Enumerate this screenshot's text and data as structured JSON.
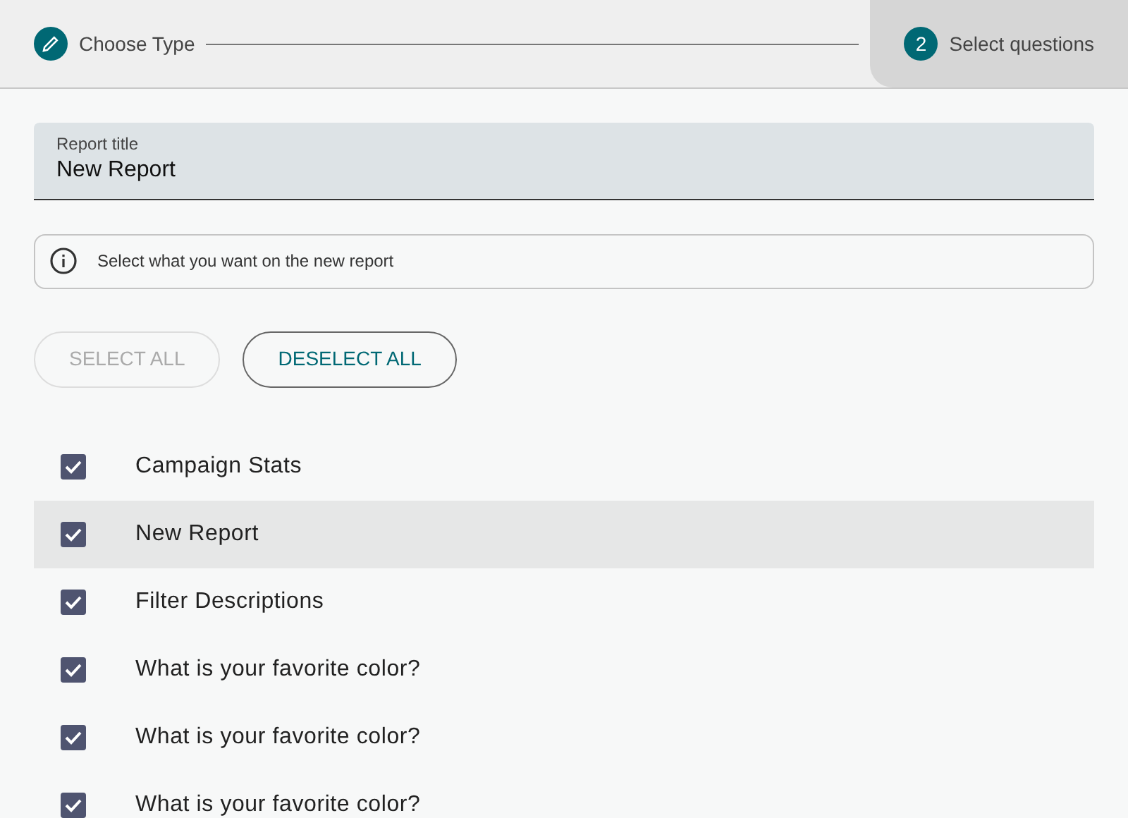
{
  "stepper": {
    "steps": [
      {
        "kind": "edit",
        "label": "Choose Type",
        "selected": false
      },
      {
        "kind": "number",
        "number": "2",
        "label": "Select questions",
        "selected": true
      }
    ]
  },
  "report_title": {
    "label": "Report title",
    "value": "New Report"
  },
  "info": {
    "text": "Select what you want on the new report"
  },
  "buttons": [
    {
      "label": "SELECT ALL",
      "disabled": true
    },
    {
      "label": "DESELECT ALL",
      "disabled": false
    }
  ],
  "questions": [
    {
      "label": "Campaign Stats",
      "checked": true,
      "highlighted": false
    },
    {
      "label": "New Report",
      "checked": true,
      "highlighted": true
    },
    {
      "label": "Filter Descriptions",
      "checked": true,
      "highlighted": false
    },
    {
      "label": "What is your favorite color?",
      "checked": true,
      "highlighted": false
    },
    {
      "label": "What is your favorite color?",
      "checked": true,
      "highlighted": false
    },
    {
      "label": "What is your favorite color?",
      "checked": true,
      "highlighted": false
    }
  ]
}
